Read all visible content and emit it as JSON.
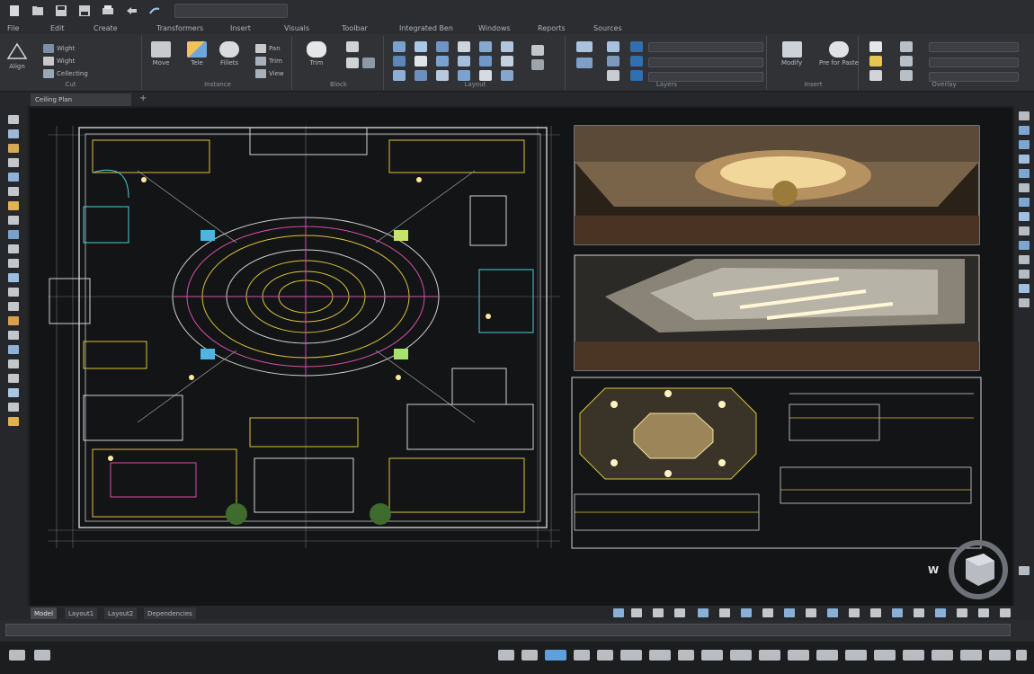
{
  "quick_access": {
    "items": [
      "new-icon",
      "open-icon",
      "save-icon",
      "save-as-icon",
      "print-icon",
      "undo-icon",
      "redo-icon"
    ],
    "workspace_value": ""
  },
  "menu": {
    "tabs": [
      "File",
      "Edit",
      "Create",
      "Transformers",
      "Insert",
      "Visuals",
      "Toolbar",
      "Integrated Ben",
      "Windows",
      "Reports",
      "Sources"
    ]
  },
  "ribbon": {
    "panels": {
      "draw": {
        "title": "Cut",
        "big_label": "Align",
        "items": [
          "Wight",
          "Wight",
          "Cellecting"
        ]
      },
      "modify": {
        "title": "Instance",
        "buttons": [
          "Move",
          "Tele",
          "Fillets"
        ],
        "items": [
          "Pan",
          "Trim",
          "View"
        ]
      },
      "annotation": {
        "title": "Block",
        "button": "Trim"
      },
      "layers": {
        "title": "Layout"
      },
      "properties": {
        "title": "Layers"
      },
      "block": {
        "title": "Insert",
        "buttons": [
          "Modify",
          "Pre for Paste"
        ]
      },
      "utilities": {
        "title": "Overlay"
      }
    }
  },
  "document_tab": {
    "label": "Ceiling Plan",
    "add_label": "+"
  },
  "layout_tabs": {
    "tabs": [
      "Model",
      "Layout1",
      "Layout2",
      "Dependencies"
    ],
    "active": "Model"
  },
  "viewcube": {
    "compass_label": "W"
  },
  "colors": {
    "accent_blue": "#3a86c8",
    "drawing_yellow": "#d8c33a",
    "drawing_magenta": "#d64fa8",
    "drawing_cyan": "#4fd0d6"
  }
}
